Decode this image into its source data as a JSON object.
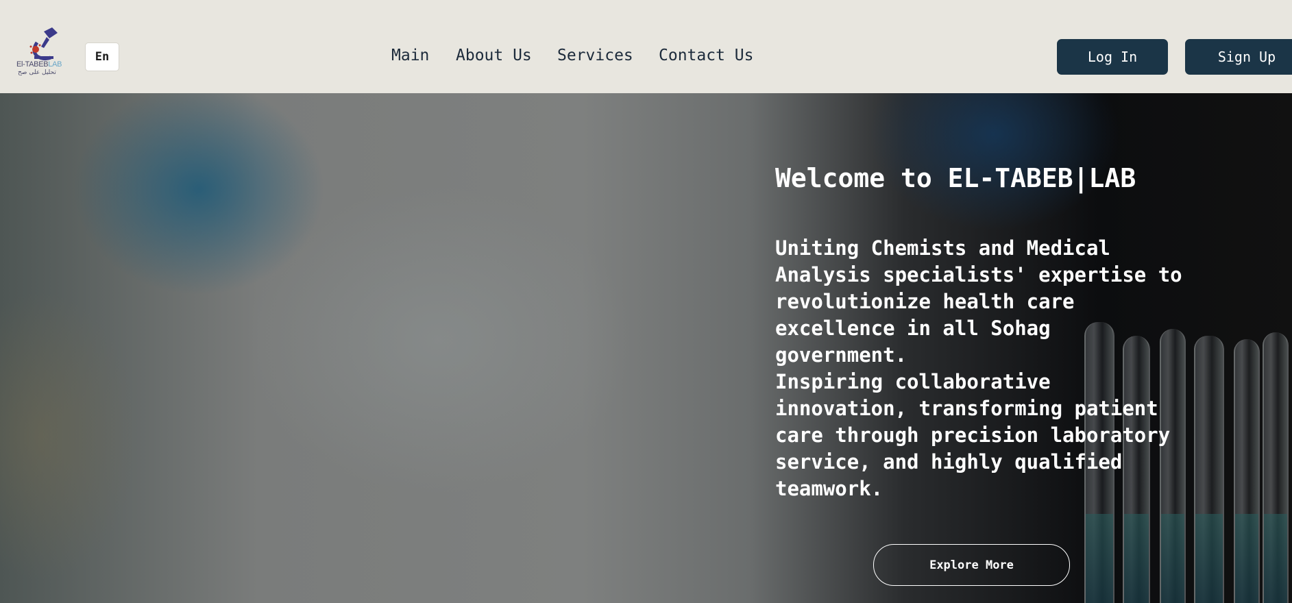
{
  "header": {
    "logo_text_main": "El-TABEB",
    "logo_text_lab": "LAB",
    "logo_subtext": "تحليل على صح",
    "lang_label": "En",
    "nav": [
      {
        "label": "Main"
      },
      {
        "label": "About Us"
      },
      {
        "label": "Services"
      },
      {
        "label": "Contact Us"
      }
    ],
    "login_label": "Log In",
    "signup_label": "Sign Up"
  },
  "hero": {
    "title": "Welcome to EL-TABEB|LAB",
    "paragraph_1": "Uniting Chemists and Medical Analysis specialists' expertise to revolutionize health care excellence in all Sohag government.",
    "paragraph_2": "Inspiring collaborative innovation, transforming patient care through precision laboratory service, and highly qualified teamwork.",
    "cta_label": "Explore More"
  },
  "colors": {
    "header_bg": "#e8e6df",
    "button_dark": "#1b3547",
    "nav_text": "#1c2a3a",
    "logo_accent": "#3b3a8a",
    "logo_red": "#c0392b"
  }
}
